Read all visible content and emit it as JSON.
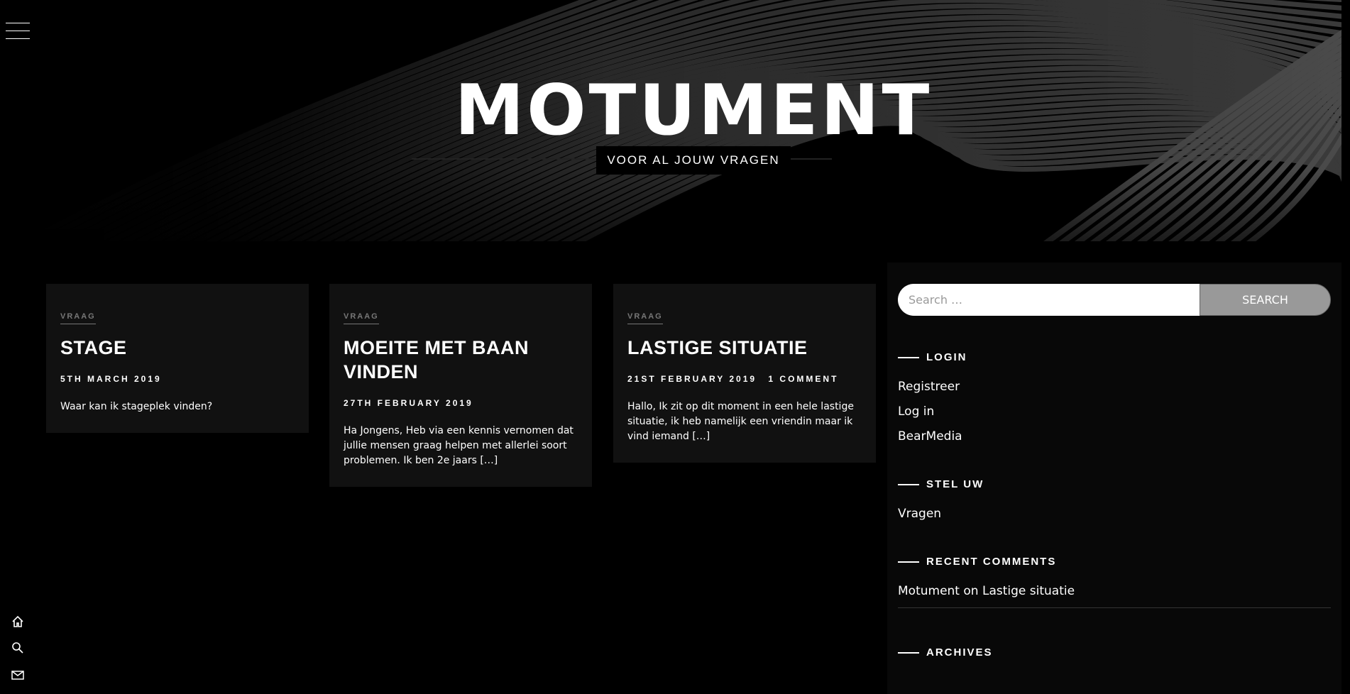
{
  "header": {
    "site_title": "MOTUMENT",
    "tagline": "VOOR AL JOUW VRAGEN"
  },
  "icons": {
    "menu": "hamburger-menu-icon",
    "home": "home-icon",
    "search": "search-icon",
    "mail": "mail-icon"
  },
  "posts": [
    {
      "category": "VRAAG",
      "title": "STAGE",
      "date": "5TH MARCH 2019",
      "comments": "",
      "excerpt": "Waar kan ik stageplek vinden?"
    },
    {
      "category": "VRAAG",
      "title": "MOEITE MET BAAN VINDEN",
      "date": "27TH FEBRUARY 2019",
      "comments": "",
      "excerpt": "Ha Jongens, Heb via een kennis vernomen dat jullie mensen graag helpen met allerlei soort problemen. Ik ben 2e jaars […]"
    },
    {
      "category": "VRAAG",
      "title": "LASTIGE SITUATIE",
      "date": "21ST FEBRUARY 2019",
      "comments": "1 COMMENT",
      "excerpt": "Hallo, Ik zit op dit moment in een hele lastige situatie, ik heb namelijk een vriendin maar ik vind iemand […]"
    }
  ],
  "sidebar": {
    "search": {
      "placeholder": "Search …",
      "button_label": "SEARCH"
    },
    "login": {
      "title": "LOGIN",
      "links": [
        "Registreer",
        "Log in",
        "BearMedia"
      ]
    },
    "stel_uw": {
      "title": "STEL UW",
      "links": [
        "Vragen"
      ]
    },
    "recent_comments": {
      "title": "RECENT COMMENTS",
      "author": "Motument",
      "on": "on",
      "post": "Lastige situatie"
    },
    "archives": {
      "title": "ARCHIVES"
    }
  },
  "colors": {
    "background": "#000000",
    "card_background": "#111111",
    "sidebar_background": "#080808",
    "search_button": "#999999",
    "category_text": "#777777"
  }
}
